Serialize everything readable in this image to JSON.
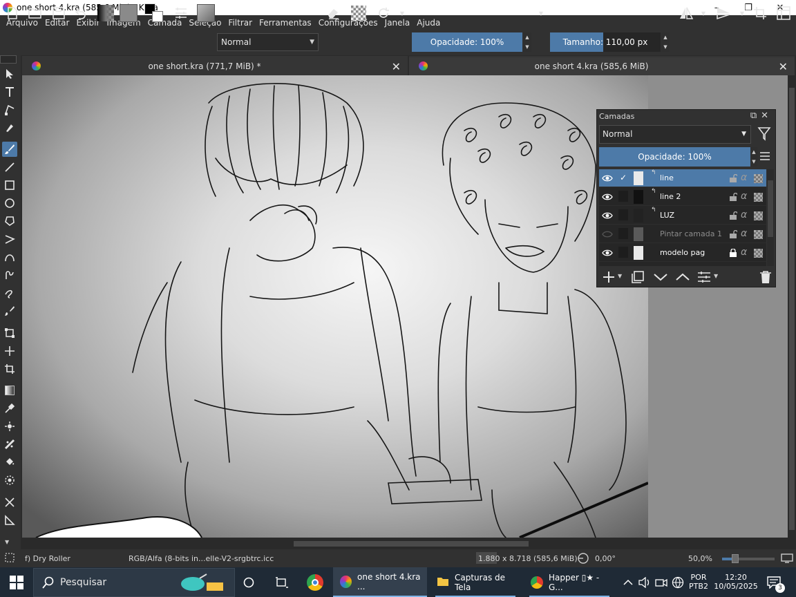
{
  "window": {
    "title": "one short 4.kra (585,6 MiB)  - Krita",
    "controls": [
      "–",
      "❐",
      "✕"
    ]
  },
  "menu": [
    "Arquivo",
    "Editar",
    "Exibir",
    "Imagem",
    "Camada",
    "Seleção",
    "Filtrar",
    "Ferramentas",
    "Configurações",
    "Janela",
    "Ajuda"
  ],
  "toolbar": {
    "blend_mode": "Normal",
    "opacity_label": "Opacidade: 100%",
    "size_label": "Tamanho: 110,00 px",
    "size_fraction": 0.48,
    "foreground_color": "#000000",
    "background_color": "#ffffff"
  },
  "tabs": [
    {
      "label": "one short.kra (771,7 MiB) *"
    },
    {
      "label": "one short 4.kra (585,6 MiB)"
    }
  ],
  "layers_docker": {
    "title": "Camadas",
    "blend_mode": "Normal",
    "opacity_label": "Opacidade:  100%",
    "layers": [
      {
        "name": "line",
        "visible": true,
        "selected": true,
        "checked": "✓",
        "locked": false
      },
      {
        "name": "line 2",
        "visible": true,
        "selected": false,
        "checked": "",
        "locked": false
      },
      {
        "name": "LUZ",
        "visible": true,
        "selected": false,
        "checked": "",
        "locked": false
      },
      {
        "name": "Pintar camada 1",
        "visible": false,
        "selected": false,
        "checked": "",
        "locked": false
      },
      {
        "name": "modelo pag",
        "visible": true,
        "selected": false,
        "checked": "",
        "locked": true
      }
    ]
  },
  "statusbar": {
    "brush": "f) Dry Roller",
    "color_profile": "RGB/Alfa (8-bits in...elle-V2-srgbtrc.icc",
    "dimensions": "1.880 x 8.718 (585,6 MiB)",
    "rotation": "0,00°",
    "zoom": "50,0%",
    "zoom_fraction": 0.25
  },
  "taskbar": {
    "search_placeholder": "Pesquisar",
    "apps": [
      {
        "label": "one short 4.kra ..."
      },
      {
        "label": "Capturas de Tela"
      },
      {
        "label": "Happer ▯★ - G..."
      }
    ],
    "language_top": "POR",
    "language_bottom": "PTB2",
    "time": "12:20",
    "date": "10/05/2025",
    "notifications": "3"
  },
  "colors": {
    "accent": "#4d7aa8",
    "panel": "#313131",
    "taskbar": "#1f2a36"
  }
}
